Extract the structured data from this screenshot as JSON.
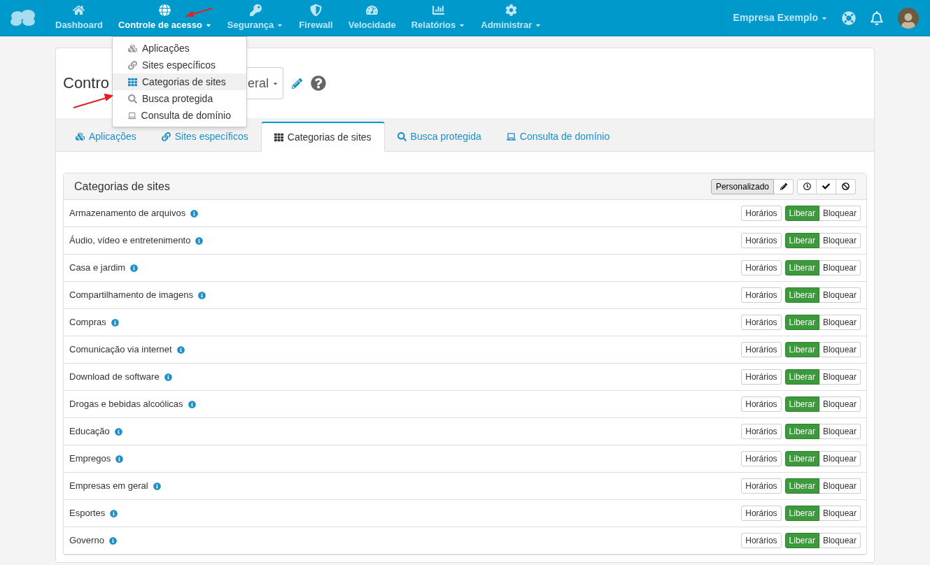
{
  "nav": {
    "items": [
      {
        "label": "Dashboard",
        "caret": false,
        "selected": false
      },
      {
        "label": "Controle de acesso",
        "caret": true,
        "selected": true
      },
      {
        "label": "Segurança",
        "caret": true,
        "selected": false
      },
      {
        "label": "Firewall",
        "caret": false,
        "selected": false
      },
      {
        "label": "Velocidade",
        "caret": false,
        "selected": false
      },
      {
        "label": "Relatórios",
        "caret": true,
        "selected": false
      },
      {
        "label": "Administrar",
        "caret": true,
        "selected": false
      }
    ],
    "company": "Empresa Exemplo"
  },
  "menu": [
    {
      "label": "Aplicações",
      "selected": false
    },
    {
      "label": "Sites específicos",
      "selected": false
    },
    {
      "label": "Categorias de sites",
      "selected": true
    },
    {
      "label": "Busca protegida",
      "selected": false
    },
    {
      "label": "Consulta de domínio",
      "selected": false
    }
  ],
  "page": {
    "title": "Contro",
    "profile_value": "eral"
  },
  "tabs": [
    {
      "label": "Aplicações",
      "selected": false
    },
    {
      "label": "Sites específicos",
      "selected": false
    },
    {
      "label": "Categorias de sites",
      "selected": true
    },
    {
      "label": "Busca protegida",
      "selected": false
    },
    {
      "label": "Consulta de domínio",
      "selected": false
    }
  ],
  "panel": {
    "title": "Categorias de sites",
    "mode": "Personalizado",
    "rows": [
      {
        "name": "Armazenamento de arquivos",
        "schedule": "Horários",
        "options": [
          {
            "label": "Liberar",
            "selected": true
          },
          {
            "label": "Bloquear",
            "selected": false
          }
        ]
      },
      {
        "name": "Áudio, vídeo e entretenimento",
        "schedule": "Horários",
        "options": [
          {
            "label": "Liberar",
            "selected": true
          },
          {
            "label": "Bloquear",
            "selected": false
          }
        ]
      },
      {
        "name": "Casa e jardim",
        "schedule": "Horários",
        "options": [
          {
            "label": "Liberar",
            "selected": true
          },
          {
            "label": "Bloquear",
            "selected": false
          }
        ]
      },
      {
        "name": "Compartilhamento de imagens",
        "schedule": "Horários",
        "options": [
          {
            "label": "Liberar",
            "selected": true
          },
          {
            "label": "Bloquear",
            "selected": false
          }
        ]
      },
      {
        "name": "Compras",
        "schedule": "Horários",
        "options": [
          {
            "label": "Liberar",
            "selected": true
          },
          {
            "label": "Bloquear",
            "selected": false
          }
        ]
      },
      {
        "name": "Comunicação via internet",
        "schedule": "Horários",
        "options": [
          {
            "label": "Liberar",
            "selected": true
          },
          {
            "label": "Bloquear",
            "selected": false
          }
        ]
      },
      {
        "name": "Download de software",
        "schedule": "Horários",
        "options": [
          {
            "label": "Liberar",
            "selected": true
          },
          {
            "label": "Bloquear",
            "selected": false
          }
        ]
      },
      {
        "name": "Drogas e bebidas alcoólicas",
        "schedule": "Horários",
        "options": [
          {
            "label": "Liberar",
            "selected": true
          },
          {
            "label": "Bloquear",
            "selected": false
          }
        ]
      },
      {
        "name": "Educação",
        "schedule": "Horários",
        "options": [
          {
            "label": "Liberar",
            "selected": true
          },
          {
            "label": "Bloquear",
            "selected": false
          }
        ]
      },
      {
        "name": "Empregos",
        "schedule": "Horários",
        "options": [
          {
            "label": "Liberar",
            "selected": true
          },
          {
            "label": "Bloquear",
            "selected": false
          }
        ]
      },
      {
        "name": "Empresas em geral",
        "schedule": "Horários",
        "options": [
          {
            "label": "Liberar",
            "selected": true
          },
          {
            "label": "Bloquear",
            "selected": false
          }
        ]
      },
      {
        "name": "Esportes",
        "schedule": "Horários",
        "options": [
          {
            "label": "Liberar",
            "selected": true
          },
          {
            "label": "Bloquear",
            "selected": false
          }
        ]
      },
      {
        "name": "Governo",
        "schedule": "Horários",
        "options": [
          {
            "label": "Liberar",
            "selected": true
          },
          {
            "label": "Bloquear",
            "selected": false
          }
        ]
      }
    ]
  }
}
